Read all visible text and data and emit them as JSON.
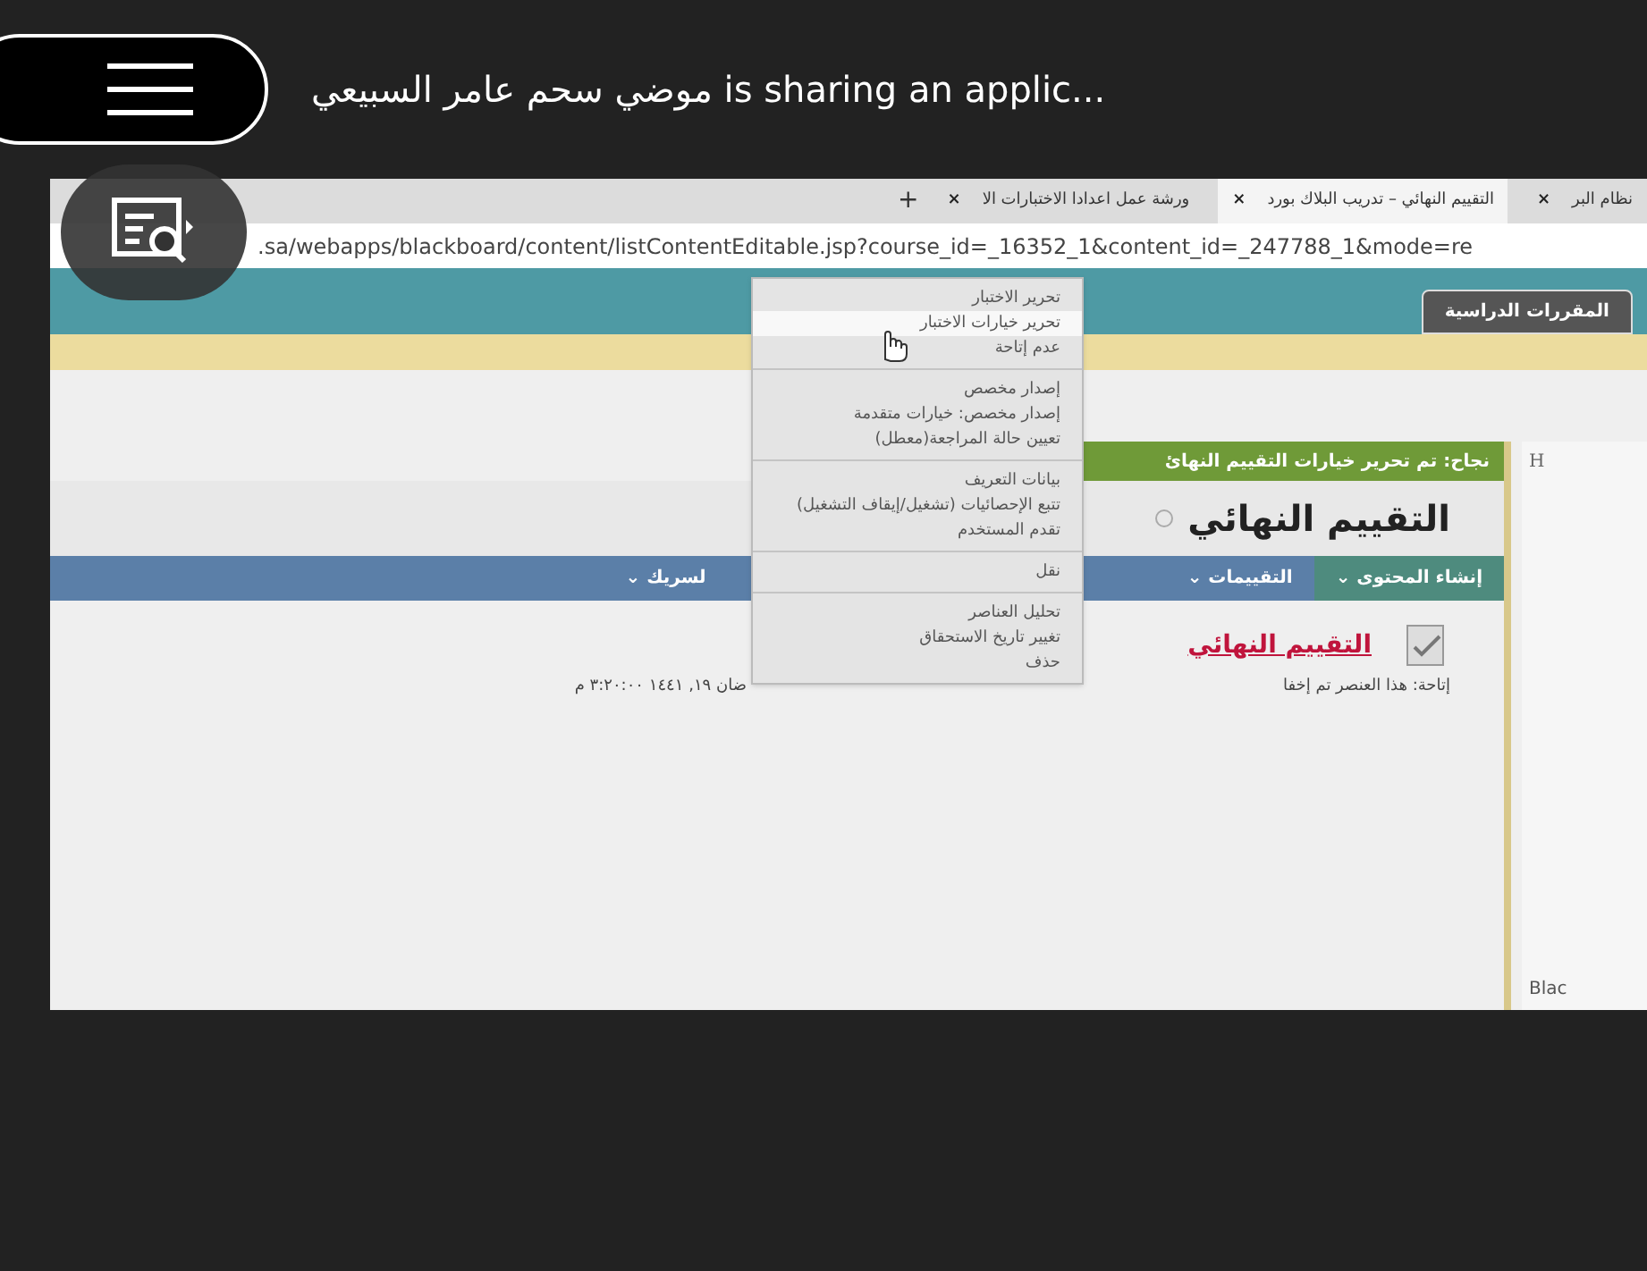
{
  "header": {
    "title": "موضي سحم عامر السبيعي is sharing an applic..."
  },
  "shared_screen": {
    "browser_tabs": [
      {
        "label": "نظام البر",
        "close": "×",
        "selected": false
      },
      {
        "label": "التقييم النهائي – تدريب البلاك بورد",
        "close": "×",
        "selected": true
      },
      {
        "label": "ورشة عمل اعدادا الاختبارات الا",
        "close": "×",
        "selected": false
      }
    ],
    "new_tab": "+",
    "url": ".sa/webapps/blackboard/content/listContentEditable.jsp?course_id=_16352_1&content_id=_247788_1&mode=re",
    "header_tab": "المقررات الدراسية",
    "success_message": "نجاح: تم تحرير خيارات التقييم النهائ",
    "page_title": "التقييم النهائي",
    "toolbar": [
      "إنشاء المحتوى ⌄",
      "التقييمات ⌄",
      "لسريك ⌄"
    ],
    "content_item": {
      "title": "التقييم النهائي",
      "availability": "إتاحة:  هذا العنصر تم إخفا",
      "date": "ضان ١٩, ١٤٤١ ٣:٢٠:٠٠ م"
    },
    "side_panel": {
      "letter": "H",
      "footer": "Blac"
    },
    "context_menu": [
      {
        "label": "تحرير الاختبار",
        "highlighted": false,
        "separator_after": false
      },
      {
        "label": "تحرير خيارات الاختبار",
        "highlighted": true,
        "separator_after": false
      },
      {
        "label": "عدم إتاحة",
        "highlighted": false,
        "separator_after": true
      },
      {
        "label": "إصدار مخصص",
        "highlighted": false,
        "separator_after": false
      },
      {
        "label": "إصدار مخصص: خيارات متقدمة",
        "highlighted": false,
        "separator_after": false
      },
      {
        "label": "تعيين حالة المراجعة(معطل)",
        "highlighted": false,
        "separator_after": true
      },
      {
        "label": "بيانات التعريف",
        "highlighted": false,
        "separator_after": false
      },
      {
        "label": "تتبع الإحصائيات (تشغيل/إيقاف التشغيل)",
        "highlighted": false,
        "separator_after": false
      },
      {
        "label": "تقدم المستخدم",
        "highlighted": false,
        "separator_after": true
      },
      {
        "label": "نقل",
        "highlighted": false,
        "separator_after": true
      },
      {
        "label": "تحليل العناصر",
        "highlighted": false,
        "separator_after": false
      },
      {
        "label": "تغيير تاريخ الاستحقاق",
        "highlighted": false,
        "separator_after": false
      },
      {
        "label": "حذف",
        "highlighted": false,
        "separator_after": false
      }
    ]
  }
}
